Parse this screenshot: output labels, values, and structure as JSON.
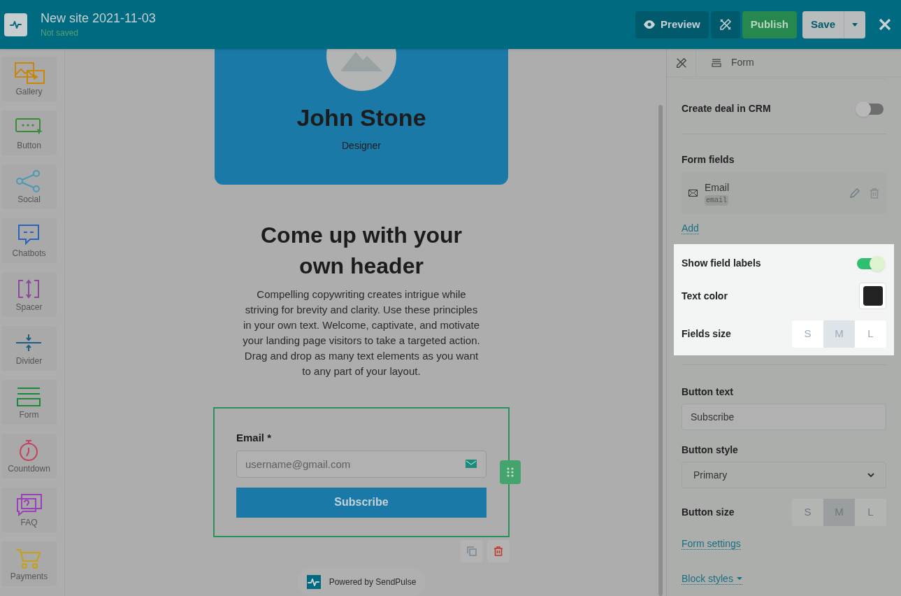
{
  "header": {
    "title": "New site 2021-11-03",
    "status": "Not saved",
    "buttons": [
      {
        "kind": "preview",
        "label": "Preview"
      },
      {
        "kind": "tools"
      },
      {
        "kind": "publish",
        "label": "Publish"
      },
      {
        "kind": "save",
        "label": "Save"
      }
    ]
  },
  "sidebar": {
    "items": [
      {
        "kind": "gallery",
        "label": "Gallery",
        "color": "#c8860a"
      },
      {
        "kind": "button",
        "label": "Button",
        "color": "#3a8a3a"
      },
      {
        "kind": "social",
        "label": "Social",
        "color": "#4a9ab5"
      },
      {
        "kind": "chatbots",
        "label": "Chatbots",
        "color": "#2a64b8"
      },
      {
        "kind": "spacer",
        "label": "Spacer",
        "color": "#8a4a9a"
      },
      {
        "kind": "divider",
        "label": "Divider",
        "color": "#1f5c80"
      },
      {
        "kind": "form",
        "label": "Form",
        "color": "#1a8a3a"
      },
      {
        "kind": "countdown",
        "label": "Countdown",
        "color": "#c84060"
      },
      {
        "kind": "faq",
        "label": "FAQ",
        "color": "#9a40b8"
      },
      {
        "kind": "payments",
        "label": "Payments",
        "color": "#c8a010"
      }
    ]
  },
  "canvas": {
    "profile": {
      "name": "John Stone",
      "role": "Designer"
    },
    "heading": "Come up with your own header",
    "paragraph": "Compelling copywriting creates intrigue while striving for brevity and clarity. Use these principles in your own text. Welcome, captivate, and motivate your landing page visitors to take a targeted action. Drag and drop as many text elements as you want to any part of your layout.",
    "form": {
      "label": "Email *",
      "placeholder": "username@gmail.com",
      "button": "Subscribe"
    },
    "powered_by": "Powered by SendPulse"
  },
  "panel": {
    "breadcrumb": "Form",
    "create_deal": {
      "label": "Create deal in CRM",
      "on": false
    },
    "form_fields_title": "Form fields",
    "fields": [
      {
        "name": "Email",
        "key": "email"
      }
    ],
    "add_link": "Add",
    "show_labels": {
      "label": "Show field labels",
      "on": true
    },
    "text_color": {
      "label": "Text color",
      "color": "#222222"
    },
    "fields_size": {
      "label": "Fields size",
      "options": [
        {
          "label": "S",
          "selected": false
        },
        {
          "label": "M",
          "selected": true
        },
        {
          "label": "L",
          "selected": false
        }
      ]
    },
    "button_text": {
      "label": "Button text",
      "value": "Subscribe"
    },
    "button_style": {
      "label": "Button style",
      "value": "Primary"
    },
    "button_size": {
      "label": "Button size",
      "options": [
        {
          "label": "S",
          "selected": false
        },
        {
          "label": "M",
          "selected": true
        },
        {
          "label": "L",
          "selected": false
        }
      ]
    },
    "form_settings_link": "Form settings",
    "block_styles_link": "Block styles"
  }
}
